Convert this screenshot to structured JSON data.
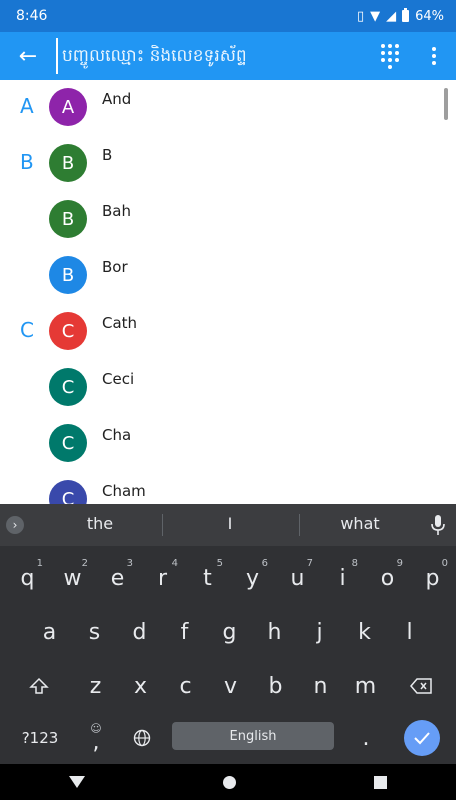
{
  "status_bar": {
    "time": "8:46",
    "battery": "64%",
    "icons": [
      "vibrate-icon",
      "wifi-icon",
      "signal-icon",
      "battery-icon"
    ]
  },
  "app_bar": {
    "search_placeholder": "បញ្ចូលឈ្មោះ និងលេខទូរស័ព្ទ",
    "back_icon": "arrow-left-icon",
    "dialpad_icon": "dialpad-icon",
    "more_icon": "more-vert-icon"
  },
  "contacts": [
    {
      "section": "A",
      "initial": "A",
      "name": "And",
      "color": "#8e24aa"
    },
    {
      "section": "B",
      "initial": "B",
      "name": "B",
      "color": "#2e7d32"
    },
    {
      "section": "",
      "initial": "B",
      "name": "Bah",
      "color": "#2e7d32"
    },
    {
      "section": "",
      "initial": "B",
      "name": "Bor",
      "color": "#1e88e5"
    },
    {
      "section": "C",
      "initial": "C",
      "name": "Cath",
      "color": "#e53935"
    },
    {
      "section": "",
      "initial": "C",
      "name": "Ceci",
      "color": "#00796b"
    },
    {
      "section": "",
      "initial": "C",
      "name": "Cha",
      "color": "#00796b"
    },
    {
      "section": "",
      "initial": "C",
      "name": "Cham",
      "color": "#3949ab"
    }
  ],
  "keyboard": {
    "suggestions": [
      "the",
      "I",
      "what"
    ],
    "row1": [
      {
        "k": "q",
        "h": "1"
      },
      {
        "k": "w",
        "h": "2"
      },
      {
        "k": "e",
        "h": "3"
      },
      {
        "k": "r",
        "h": "4"
      },
      {
        "k": "t",
        "h": "5"
      },
      {
        "k": "y",
        "h": "6"
      },
      {
        "k": "u",
        "h": "7"
      },
      {
        "k": "i",
        "h": "8"
      },
      {
        "k": "o",
        "h": "9"
      },
      {
        "k": "p",
        "h": "0"
      }
    ],
    "row2": [
      "a",
      "s",
      "d",
      "f",
      "g",
      "h",
      "j",
      "k",
      "l"
    ],
    "row3": [
      "z",
      "x",
      "c",
      "v",
      "b",
      "n",
      "m"
    ],
    "symbols_label": "?123",
    "comma_label": ",",
    "space_label": "English",
    "period_label": "."
  }
}
